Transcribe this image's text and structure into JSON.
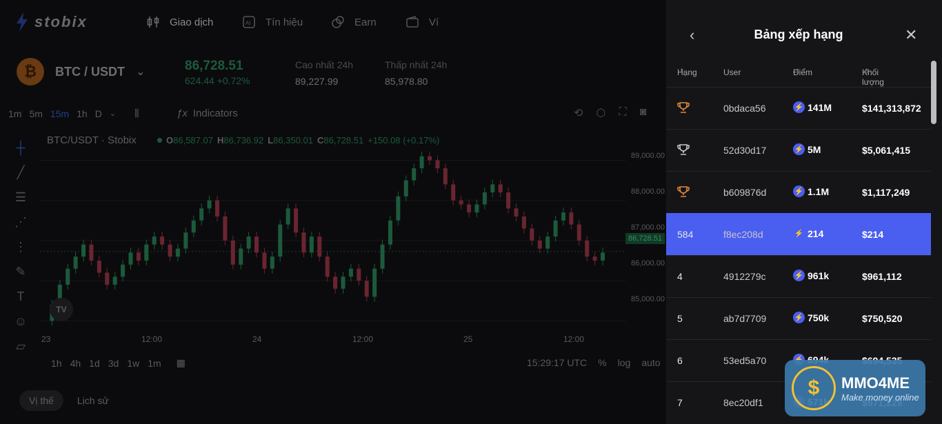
{
  "nav": {
    "logo_text": "stobix",
    "items": [
      {
        "label": "Giao dịch",
        "icon": "candles-icon"
      },
      {
        "label": "Tín hiệu",
        "icon": "ai-icon"
      },
      {
        "label": "Earn",
        "icon": "coins-icon"
      },
      {
        "label": "Ví",
        "icon": "wallet-icon"
      }
    ]
  },
  "ticker": {
    "pair": "BTC / USDT",
    "price": "86,728.51",
    "change": "624.44",
    "change_pct": "+0.72%",
    "high_label": "Cao nhất 24h",
    "high_value": "89,227.99",
    "low_label": "Thấp nhất 24h",
    "low_value": "85,978.80"
  },
  "toolbar": {
    "timeframes": [
      "1m",
      "5m",
      "15m",
      "1h",
      "D"
    ],
    "active_timeframe": "15m",
    "indicators_label": "Indicators"
  },
  "chart_header": {
    "title": "BTC/USDT · Stobix",
    "o_label": "O",
    "o_value": "86,587.07",
    "h_label": "H",
    "h_value": "86,736.92",
    "l_label": "L",
    "l_value": "86,350.01",
    "c_label": "C",
    "c_value": "86,728.51",
    "change": "+150.08 (+0.17%)"
  },
  "chart_data": {
    "type": "line",
    "title": "BTC/USDT · Stobix",
    "y_ticks": [
      "89,000.00",
      "88,000.00",
      "87,000.00",
      "86,000.00",
      "85,000.00"
    ],
    "x_ticks": [
      "23",
      "12:00",
      "24",
      "12:00",
      "25",
      "12:00"
    ],
    "ylim": [
      84800,
      89300
    ],
    "current_price": "86,728.51",
    "series": [
      {
        "values": [
          85000,
          85400,
          85900,
          86300,
          86600,
          86900,
          86500,
          86200,
          85900,
          86100,
          86400,
          86700,
          86500,
          86900,
          87100,
          86900,
          86600,
          86800,
          87200,
          87500,
          87800,
          88000,
          87600,
          87000,
          86400,
          86800,
          87100,
          86700,
          86300,
          86600,
          87400,
          87800,
          87200,
          86700,
          87100,
          86600,
          86100,
          85800,
          86100,
          86300,
          86000,
          85600,
          86300,
          86900,
          87500,
          88100,
          88500,
          88800,
          89100,
          89000,
          88800,
          88400,
          88000,
          87900,
          87700,
          87900,
          88200,
          88400,
          88200,
          87800,
          87600,
          87300,
          87000,
          86800,
          87100,
          87500,
          87700,
          87400,
          87000,
          86600,
          86500,
          86700
        ]
      }
    ]
  },
  "chart": {
    "tv_label": "TV"
  },
  "range_bar": {
    "ranges": [
      "1h",
      "4h",
      "1d",
      "3d",
      "1w",
      "1m"
    ],
    "time": "15:29:17 UTC",
    "pct": "%",
    "log": "log",
    "auto": "auto"
  },
  "bottom_tabs": [
    "Vị thế",
    "Lịch sử"
  ],
  "leaderboard": {
    "title": "Bảng xếp hạng",
    "col_rank": "Hạng",
    "col_user": "User",
    "col_points": "Điểm",
    "col_volume": "Khối lượng",
    "rows": [
      {
        "rank": "",
        "trophy": "gold",
        "user": "0bdaca56",
        "points": "141M",
        "volume": "$141,313,872"
      },
      {
        "rank": "",
        "trophy": "silver",
        "user": "52d30d17",
        "points": "5M",
        "volume": "$5,061,415"
      },
      {
        "rank": "",
        "trophy": "bronze",
        "user": "b609876d",
        "points": "1.1M",
        "volume": "$1,117,249"
      },
      {
        "rank": "584",
        "trophy": "",
        "user": "f8ec208d",
        "points": "214",
        "volume": "$214"
      },
      {
        "rank": "4",
        "trophy": "",
        "user": "4912279c",
        "points": "961k",
        "volume": "$961,112"
      },
      {
        "rank": "5",
        "trophy": "",
        "user": "ab7d7709",
        "points": "750k",
        "volume": "$750,520"
      },
      {
        "rank": "6",
        "trophy": "",
        "user": "53ed5a70",
        "points": "694k",
        "volume": "$694,535"
      },
      {
        "rank": "7",
        "trophy": "",
        "user": "8ec20df1",
        "points": "571k",
        "volume": "$571,229"
      }
    ]
  },
  "watermark": {
    "brand": "MMO4ME",
    "tagline": "Make money online"
  },
  "colors": {
    "accent": "#4a5ef0",
    "up": "#1c5a3c",
    "down": "#6a2530",
    "gold": "#e08a3a",
    "silver": "#c8c8c8"
  }
}
